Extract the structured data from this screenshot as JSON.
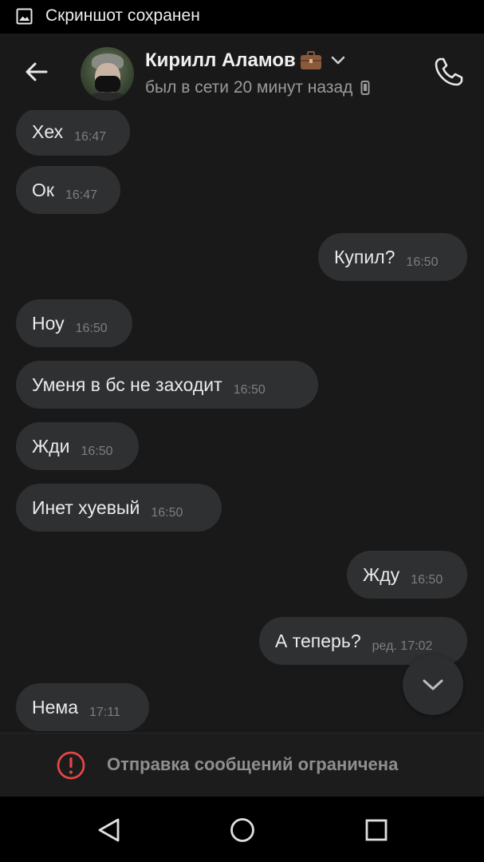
{
  "status_bar": {
    "icon": "image-icon",
    "text": "Скриншот сохранен"
  },
  "header": {
    "name": "Кирилл Аламов",
    "name_icon": "briefcase-icon",
    "presence": "был в сети 20 минут назад",
    "presence_icon": "mobile-phone-icon"
  },
  "messages": [
    {
      "side": "in",
      "text": "Хех",
      "time": "16:47"
    },
    {
      "side": "in",
      "text": "Ок",
      "time": "16:47"
    },
    {
      "side": "out",
      "text": "Купил?",
      "time": "16:50"
    },
    {
      "side": "in",
      "text": "Ноу",
      "time": "16:50"
    },
    {
      "side": "in",
      "text": "Уменя в бс не заходит",
      "time": "16:50"
    },
    {
      "side": "in",
      "text": "Жди",
      "time": "16:50"
    },
    {
      "side": "in",
      "text": "Инет хуевый",
      "time": "16:50"
    },
    {
      "side": "out",
      "text": "Жду",
      "time": "16:50"
    },
    {
      "side": "out",
      "text": "А теперь?",
      "time": "ред. 17:02"
    },
    {
      "side": "in",
      "text": "Нема",
      "time": "17:11"
    }
  ],
  "footer": {
    "text": "Отправка сообщений ограничена"
  },
  "colors": {
    "background": "#19191a",
    "bubble": "#2f3031",
    "warning": "#e64646"
  }
}
